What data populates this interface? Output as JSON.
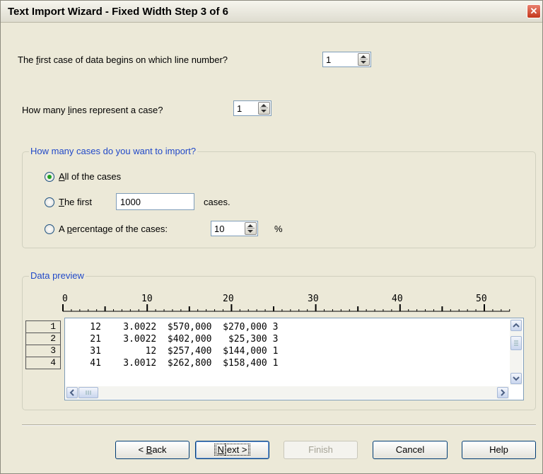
{
  "window": {
    "title": "Text Import Wizard - Fixed Width Step 3 of 6",
    "close_glyph": "✕"
  },
  "first_case": {
    "label_pre": "The ",
    "label_u": "f",
    "label_post": "irst case of data begins on which line number?",
    "value": "1"
  },
  "lines_per_case": {
    "label_pre": "How many ",
    "label_u": "l",
    "label_post": "ines represent a case?",
    "value": "1"
  },
  "cases_group": {
    "title": "How many cases do you want to import?",
    "all": {
      "u": "A",
      "rest": "ll of the cases",
      "checked": true
    },
    "first": {
      "u": "T",
      "rest": "he first",
      "value": "1000",
      "suffix": "cases."
    },
    "percentage": {
      "pre": "A ",
      "u": "p",
      "rest": "ercentage of the cases:",
      "value": "10",
      "suffix": "%"
    }
  },
  "data_preview": {
    "title": "Data preview",
    "ruler": [
      "0",
      "10",
      "20",
      "30",
      "40",
      "50"
    ],
    "row_numbers": [
      "1",
      "2",
      "3",
      "4"
    ],
    "rows": [
      "    12    3.0022  $570,000  $270,000 3",
      "    21    3.0022  $402,000   $25,300 3",
      "    31        12  $257,400  $144,000 1",
      "    41    3.0012  $262,800  $158,400 1"
    ]
  },
  "buttons": {
    "back": {
      "pre": "< ",
      "u": "B",
      "rest": "ack"
    },
    "next": {
      "u": "N",
      "rest": "ext >"
    },
    "finish": "Finish",
    "cancel": "Cancel",
    "help": "Help"
  }
}
